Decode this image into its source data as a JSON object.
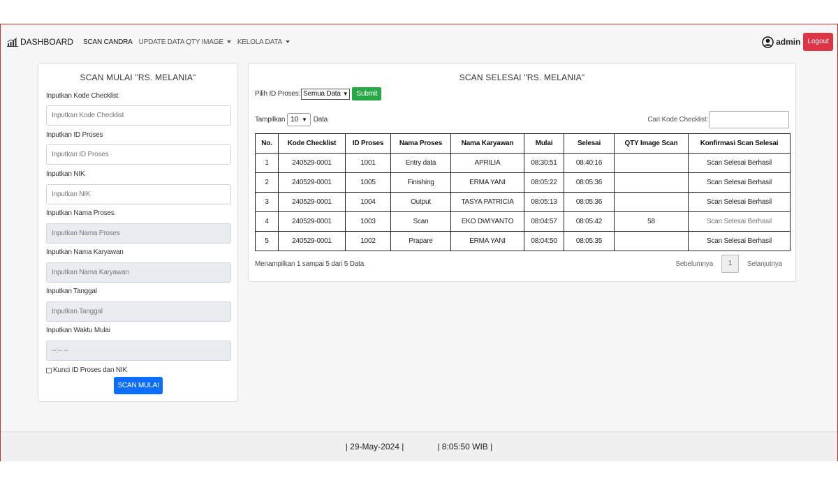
{
  "nav": {
    "brand": "DASHBOARD",
    "items": [
      {
        "label": "SCAN CANDRA",
        "dropdown": false
      },
      {
        "label": "UPDATE DATA QTY IMAGE",
        "dropdown": true
      },
      {
        "label": "KELOLA DATA",
        "dropdown": true
      }
    ],
    "user": "admin",
    "logout": "Logout"
  },
  "left": {
    "title": "SCAN MULAI \"RS. MELANIA\"",
    "fields": [
      {
        "label": "Inputkan Kode Checklist",
        "placeholder": "Inputkan Kode Checklist",
        "disabled": false
      },
      {
        "label": "Inputkan ID Proses",
        "placeholder": "Inputkan ID Proses",
        "disabled": false
      },
      {
        "label": "Inputkan NIK",
        "placeholder": "Inputkan NIK",
        "disabled": false
      },
      {
        "label": "Inputkan Nama Proses",
        "placeholder": "Inputkan Nama Proses",
        "disabled": true
      },
      {
        "label": "Inputkan Nama Karyawan",
        "placeholder": "Inputkan Nama Karyawan",
        "disabled": true
      },
      {
        "label": "Inputkan Tanggal",
        "placeholder": "Inputkan Tanggal",
        "disabled": true
      },
      {
        "label": "Inputkan Waktu Mulai",
        "placeholder": "--:-- --",
        "disabled": true
      }
    ],
    "lock_label": "Kunci ID Proses dan NIK",
    "submit": "SCAN MULAI"
  },
  "right": {
    "title": "SCAN SELESAI \"RS. MELANIA\"",
    "filter_label": "Pilih ID Proses:",
    "filter_value": "Semua Data",
    "filter_submit": "Submit",
    "show_prefix": "Tampilkan",
    "show_value": "10",
    "show_suffix": "Data",
    "search_label": "Cari Kode Checklist:",
    "columns": [
      "No.",
      "Kode Checklist",
      "ID Proses",
      "Nama Proses",
      "Nama Karyawan",
      "Mulai",
      "Selesai",
      "QTY Image Scan",
      "Konfirmasi Scan Selesai"
    ],
    "rows": [
      [
        "1",
        "240529-0001",
        "1001",
        "Entry data",
        "APRILIA",
        "08:30:51",
        "08:40:16",
        "",
        "Scan Selesai Berhasil"
      ],
      [
        "2",
        "240529-0001",
        "1005",
        "Finishing",
        "ERMA YANI",
        "08:05:22",
        "08:05:36",
        "",
        "Scan Selesai Berhasil"
      ],
      [
        "3",
        "240529-0001",
        "1004",
        "Output",
        "TASYA PATRICIA",
        "08:05:13",
        "08:05:36",
        "",
        "Scan Selesai Berhasil"
      ],
      [
        "4",
        "240529-0001",
        "1003",
        "Scan",
        "EKO DWIYANTO",
        "08:04:57",
        "08:05:42",
        "58",
        "Scan Selesai Berhasil"
      ],
      [
        "5",
        "240529-0001",
        "1002",
        "Prapare",
        "ERMA YANI",
        "08:04:50",
        "08:05:35",
        "",
        "Scan Selesai Berhasil"
      ]
    ],
    "info": "Menampilkan 1 sampai 5 dari 5 Data",
    "prev": "Sebelumnya",
    "page": "1",
    "next": "Selanjutnya"
  },
  "footer": {
    "date": "| 29-May-2024 |",
    "time": "| 8:05:50 WIB |"
  }
}
